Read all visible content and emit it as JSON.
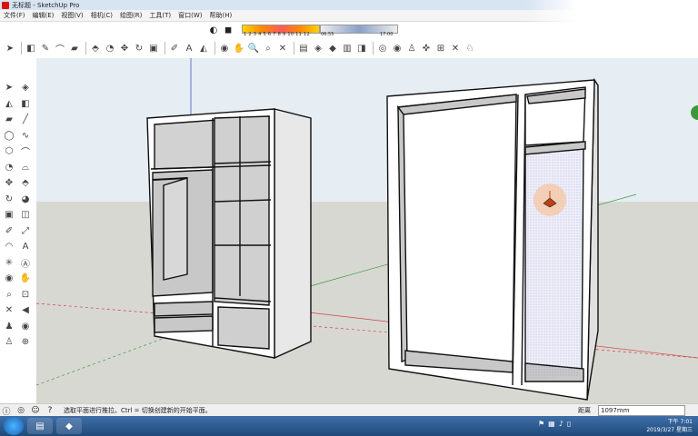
{
  "window": {
    "title": "无标题 - SketchUp Pro"
  },
  "menu": [
    "文件(F)",
    "编辑(E)",
    "视图(V)",
    "相机(C)",
    "绘图(R)",
    "工具(T)",
    "窗口(W)",
    "帮助(H)"
  ],
  "shadow_bar": {
    "months": "1 2 3 4 5 6 7 8 9 10 11 12",
    "time_start": "06:55",
    "time_mid": "中午",
    "time_end": "17:00"
  },
  "status": {
    "message": "选取平面进行推拉。Ctrl = 切换创建新的开始平面。",
    "distance_label": "距离",
    "distance_value": "1097mm"
  },
  "taskbar": {
    "time": "下午 7:01",
    "date": "2019/3/27 星期三"
  },
  "icons": {
    "toolbar": [
      "select-arrow-icon",
      "eraser-icon",
      "pencil-icon",
      "arc-icon",
      "rectangle-icon",
      "push-pull-icon",
      "follow-me-icon",
      "move-icon",
      "rotate-icon",
      "scale-icon",
      "tape-measure-icon",
      "paint-bucket-icon",
      "orbit-icon",
      "pan-icon",
      "zoom-icon",
      "zoom-extents-icon",
      "components-icon",
      "materials-icon",
      "styles-icon",
      "layers-icon",
      "section-plane-icon",
      "walk-icon",
      "look-around-icon",
      "position-camera-icon"
    ],
    "left": [
      "select-arrow-icon",
      "component-icon",
      "paint-icon",
      "eraser-icon",
      "rectangle-icon",
      "line-icon",
      "circle-icon",
      "freehand-icon",
      "polygon-icon",
      "arc-icon",
      "pie-icon",
      "arc3-icon",
      "move-icon",
      "push-pull-icon",
      "rotate-icon",
      "follow-me-icon",
      "scale-icon",
      "offset-icon",
      "tape-icon",
      "dimension-icon",
      "protractor-icon",
      "text-icon",
      "axes-icon",
      "3d-text-icon",
      "orbit-icon",
      "pan-icon",
      "zoom-icon",
      "zoom-window-icon",
      "zoom-extents-icon",
      "previous-icon",
      "position-camera-icon",
      "look-around-icon",
      "walk-icon",
      "section-icon"
    ]
  }
}
